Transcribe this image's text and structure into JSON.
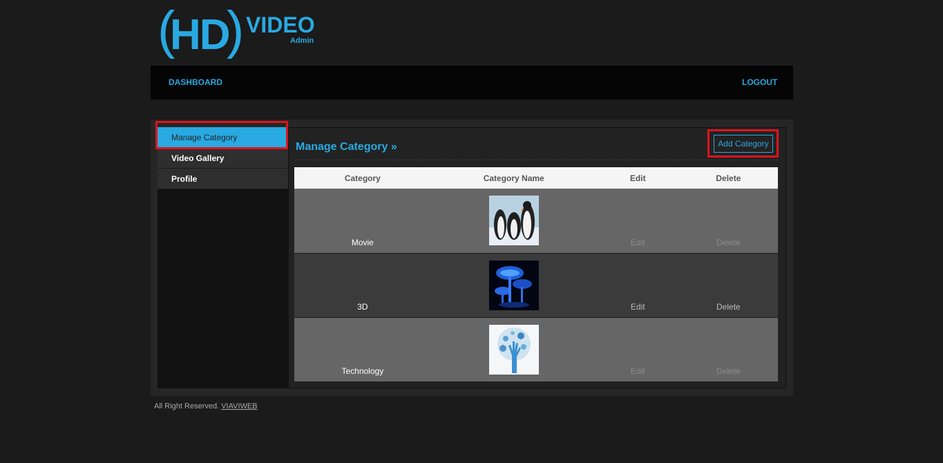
{
  "logo": {
    "hd": "HD",
    "video": "VIDEO",
    "admin": "Admin"
  },
  "topnav": {
    "dashboard": "DASHBOARD",
    "logout": "LOGOUT"
  },
  "sidebar": {
    "items": [
      {
        "label": "Manage Category",
        "active": true
      },
      {
        "label": "Video Gallery",
        "active": false
      },
      {
        "label": "Profile",
        "active": false
      }
    ]
  },
  "main": {
    "title": "Manage Category »",
    "add_button": "Add Category",
    "table": {
      "headers": [
        "Category",
        "Category Name",
        "Edit",
        "Delete"
      ],
      "rows": [
        {
          "category": "Movie",
          "image": "penguins-image",
          "edit": "Edit",
          "delete": "Delete"
        },
        {
          "category": "3D",
          "image": "glowing-mushrooms-image",
          "edit": "Edit",
          "delete": "Delete"
        },
        {
          "category": "Technology",
          "image": "tech-hand-tree-image",
          "edit": "Edit",
          "delete": "Delete"
        }
      ]
    }
  },
  "footer": {
    "text": "All Right Reserved.",
    "link": "VIAVIWEB"
  },
  "colors": {
    "accent": "#29a9e1",
    "highlight": "#e0131b",
    "background": "#1b1b1b"
  }
}
